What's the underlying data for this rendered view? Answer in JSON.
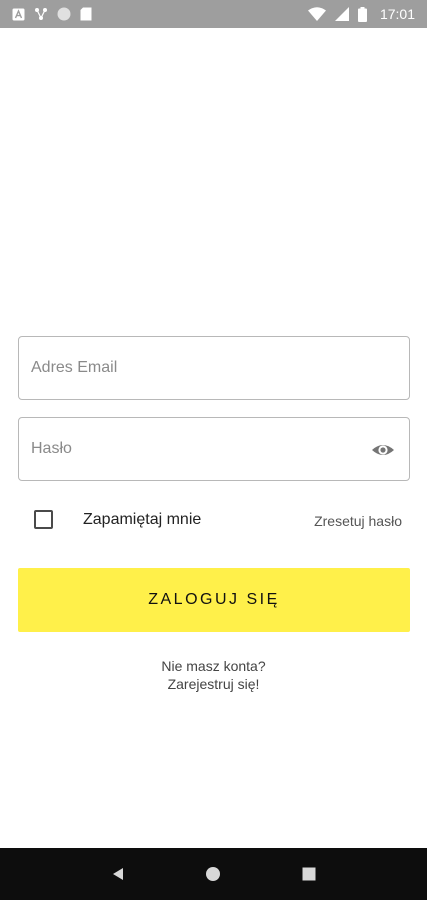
{
  "status_bar": {
    "time": "17:01",
    "icons_left": [
      "a-box-icon",
      "nodes-icon",
      "circle-icon",
      "sd-card-icon"
    ],
    "icons_right": [
      "wifi-icon",
      "cell-signal-icon",
      "battery-icon"
    ],
    "background": "#9e9e9e"
  },
  "login_form": {
    "email": {
      "placeholder": "Adres Email",
      "value": ""
    },
    "password": {
      "placeholder": "Hasło",
      "value": "",
      "toggle_icon": "eye-icon"
    },
    "remember_me": {
      "label": "Zapamiętaj mnie",
      "checked": false
    },
    "reset_password_label": "Zresetuj hasło",
    "login_button_label": "ZALOGUJ SIĘ",
    "login_button_color": "#fff04a"
  },
  "register": {
    "line1": "Nie masz konta?",
    "line2": "Zarejestruj się!"
  },
  "nav_bar": {
    "buttons": [
      "back-icon",
      "home-icon",
      "recents-icon"
    ],
    "background": "#0d0d0d"
  }
}
